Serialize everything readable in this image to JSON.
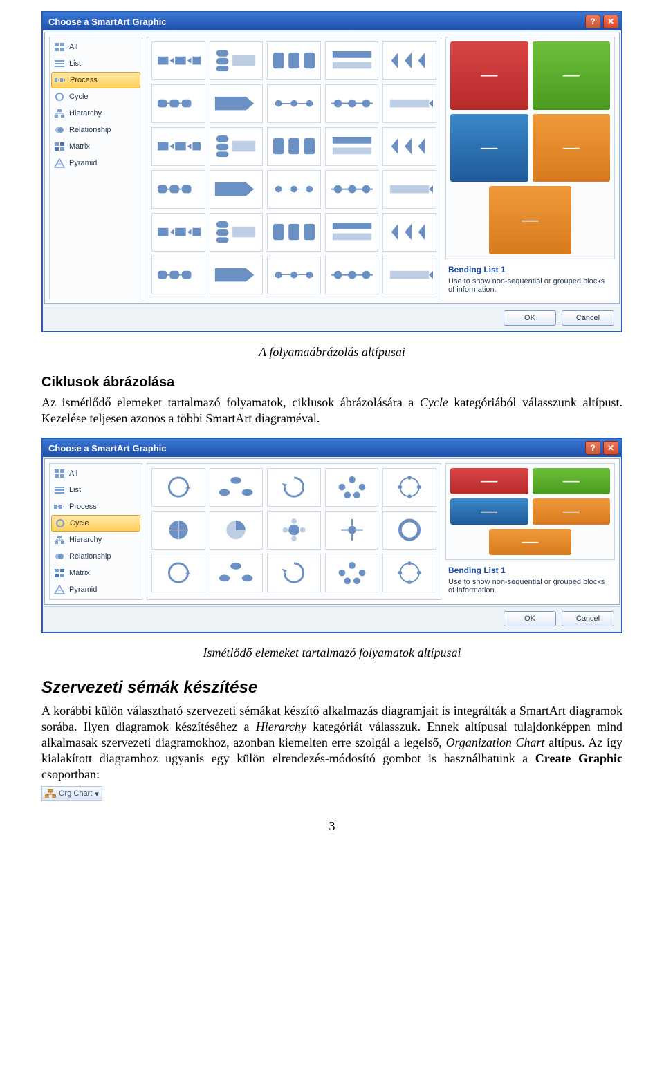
{
  "dialog": {
    "title": "Choose a SmartArt Graphic",
    "helpSymbol": "?",
    "closeSymbol": "✕",
    "ok": "OK",
    "cancel": "Cancel",
    "categories": [
      {
        "label": "All"
      },
      {
        "label": "List"
      },
      {
        "label": "Process"
      },
      {
        "label": "Cycle"
      },
      {
        "label": "Hierarchy"
      },
      {
        "label": "Relationship"
      },
      {
        "label": "Matrix"
      },
      {
        "label": "Pyramid"
      }
    ],
    "preview": {
      "name": "Bending List 1",
      "desc": "Use to show non-sequential or grouped blocks of information.",
      "dash": "—"
    }
  },
  "topDialog": {
    "selectedIndex": 2,
    "thumbCount": 30
  },
  "midDialog": {
    "selectedIndex": 3,
    "thumbCount": 15
  },
  "captions": {
    "top": "A folyamaábrázolás altípusai",
    "mid": "Ismétlődő elemeket tartalmazó folyamatok altípusai"
  },
  "headings": {
    "ciklusok": "Ciklusok ábrázolása",
    "szervezeti": "Szervezeti sémák készítése"
  },
  "paragraphs": {
    "ciklusok_pre": "Az ismétlődő elemeket tartalmazó folyamatok, ciklusok ábrázolására a ",
    "ciklusok_term": "Cycle",
    "ciklusok_post": " kategóriából válasszunk altípust. Kezelése teljesen azonos a többi SmartArt diagraméval.",
    "szerv_pre": "A korábbi külön választható szervezeti sémákat készítő alkalmazás diagramjait is integrálták a SmartArt diagramok sorába. Ilyen diagramok készítéséhez a ",
    "szerv_term1": "Hierarchy",
    "szerv_mid1": " kategóriát válasszuk. Ennek altípusai tulajdonképpen mind alkalmasak szervezeti diagramokhoz, azonban kiemelten erre szolgál a legelső, ",
    "szerv_term2": "Organization Chart",
    "szerv_mid2": " altípus. Az így kialakított diagramhoz ugyanis egy külön elrendezés-módosító gombot is használhatunk a ",
    "szerv_bold": "Create Graphic",
    "szerv_post": " csoportban:"
  },
  "chip": {
    "label": "Org Chart",
    "dropdown": "▾"
  },
  "pageNumber": "3"
}
